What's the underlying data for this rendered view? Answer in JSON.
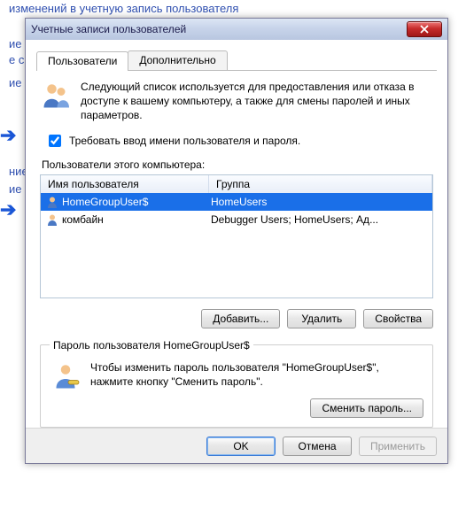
{
  "background": {
    "line1": "изменений в учетную запись пользователя",
    "snip2": "ие",
    "snip3": "е св",
    "snip4": "ие",
    "snip5": "ние",
    "snip6": "ие"
  },
  "dialog": {
    "title": "Учетные записи пользователей",
    "tabs": {
      "users": "Пользователи",
      "advanced": "Дополнительно"
    },
    "intro": "Следующий список используется для предоставления или отказа в доступе к вашему компьютеру, а также для смены паролей и иных параметров.",
    "require_login_label": "Требовать ввод имени пользователя и пароля.",
    "require_login_checked": true,
    "list_caption": "Пользователи этого компьютера:",
    "columns": {
      "user": "Имя пользователя",
      "group": "Группа"
    },
    "users": [
      {
        "name": "HomeGroupUser$",
        "group": "HomeUsers",
        "selected": true
      },
      {
        "name": "комбайн",
        "group": "Debugger Users; HomeUsers; Ад...",
        "selected": false
      }
    ],
    "buttons": {
      "add": "Добавить...",
      "remove": "Удалить",
      "props": "Свойства"
    },
    "password_box": {
      "legend": "Пароль пользователя HomeGroupUser$",
      "text": "Чтобы изменить пароль пользователя \"HomeGroupUser$\", нажмите кнопку \"Сменить пароль\".",
      "change_btn": "Сменить пароль..."
    },
    "footer": {
      "ok": "OK",
      "cancel": "Отмена",
      "apply": "Применить"
    }
  }
}
